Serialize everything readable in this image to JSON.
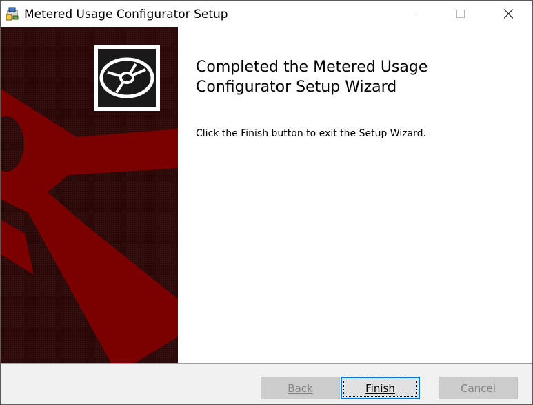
{
  "window": {
    "title": "Metered Usage Configurator Setup",
    "icon": "installer-icon",
    "controls": [
      "minimize-icon",
      "maximize-icon",
      "close-icon"
    ]
  },
  "banner": {
    "artwork": "anchor-graphic",
    "logo": "disc-icon",
    "colors": {
      "dark": "#2b0a0a",
      "red": "#7b0000",
      "frame": "#ffffff"
    }
  },
  "main": {
    "heading": "Completed the Metered Usage Configurator Setup Wizard",
    "body": "Click the Finish button to exit the Setup Wizard."
  },
  "buttons": {
    "back": "Back",
    "finish": "Finish",
    "cancel": "Cancel"
  },
  "colors": {
    "focus_border": "#0078d7",
    "disabled_text": "#838383"
  }
}
